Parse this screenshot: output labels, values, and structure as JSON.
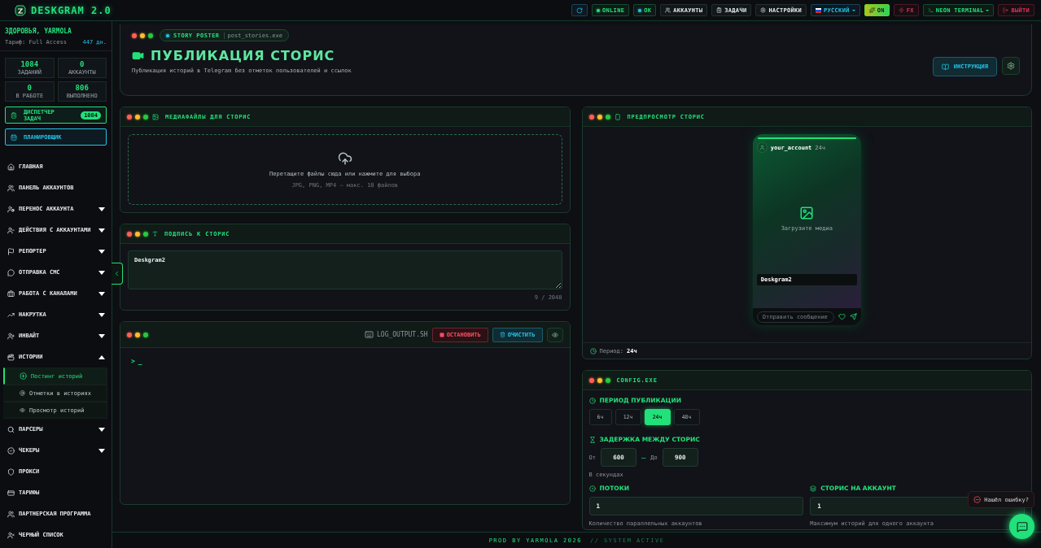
{
  "topbar": {
    "logo": "DESKGRAM 2.0",
    "buttons": [
      {
        "kind": "refresh"
      },
      {
        "kind": "status",
        "label": "ONLINE"
      },
      {
        "kind": "status",
        "label": "OK"
      },
      {
        "kind": "nav",
        "label": "АККАУНТЫ"
      },
      {
        "kind": "nav",
        "label": "ЗАДАЧИ"
      },
      {
        "kind": "nav",
        "label": "НАСТРОЙКИ"
      },
      {
        "kind": "lang",
        "label": "РУССКИЙ"
      },
      {
        "kind": "toggle",
        "label": "ON",
        "on": true
      },
      {
        "kind": "fx",
        "label": "FX"
      },
      {
        "kind": "theme",
        "label": "NEON TERMINAL"
      },
      {
        "kind": "logout",
        "label": "ВЫЙТИ"
      }
    ]
  },
  "sidebar": {
    "greeting": "ЗДОРОВЬЯ, YARMOLA",
    "tariff": "Тариф: Full Access",
    "days": "447 дн.",
    "stats": [
      {
        "value": "1084",
        "label": "ЗАДАНИЙ"
      },
      {
        "value": "0",
        "label": "АККАУНТЫ"
      },
      {
        "value": "0",
        "label": "В РАБОТЕ"
      },
      {
        "value": "806",
        "label": "ВЫПОЛНЕНО"
      }
    ],
    "task_dispatcher": {
      "label": "ДИСПЕТЧЕР ЗАДАЧ",
      "badge": "1084"
    },
    "scheduler": {
      "label": "ПЛАНИРОВЩИК"
    },
    "items": [
      {
        "label": "ГЛАВНАЯ"
      },
      {
        "label": "ПАНЕЛЬ АККАУНТОВ"
      },
      {
        "label": "ПЕРЕНОС АККАУНТА",
        "expanded": false
      },
      {
        "label": "ДЕЙСТВИЯ С АККАУНТАМИ",
        "expanded": false
      },
      {
        "label": "РЕПОРТЕР",
        "expanded": false
      },
      {
        "label": "ОТПРАВКА СМС",
        "expanded": false
      },
      {
        "label": "РАБОТА С КАНАЛАМИ",
        "expanded": false
      },
      {
        "label": "НАКРУТКА",
        "expanded": false
      },
      {
        "label": "ИНВАЙТ",
        "expanded": false
      },
      {
        "label": "ИСТОРИИ",
        "expanded": true,
        "children": [
          {
            "label": "Постинг историй",
            "selected": true
          },
          {
            "label": "Отметки в историях",
            "selected": false
          },
          {
            "label": "Просмотр историй",
            "selected": false
          }
        ]
      },
      {
        "label": "ПАРСЕРЫ",
        "expanded": false
      },
      {
        "label": "ЧЕКЕРЫ",
        "expanded": false
      },
      {
        "label": "ПРОКСИ"
      },
      {
        "label": "ТАРИФЫ"
      },
      {
        "label": "ПАРТНЕРСКАЯ ПРОГРАММА"
      },
      {
        "label": "ЧЕРНЫЙ СПИСОК"
      }
    ]
  },
  "header": {
    "tag": "STORY POSTER",
    "file": "post_stories.exe",
    "title": "ПУБЛИКАЦИЯ СТОРИС",
    "description": "Публикация историй в Telegram без отметок пользователей и ссылок",
    "instruction_button": "ИНСТРУКЦИЯ"
  },
  "media": {
    "title": "МЕДИАФАЙЛЫ ДЛЯ СТОРИС",
    "drop_text": "Перетащите файлы сюда или нажмите для выбора",
    "drop_hint": "JPG, PNG, MP4 — макс. 10 файлов"
  },
  "caption": {
    "title": "ПОДПИСЬ К СТОРИС",
    "value": "Deskgram2",
    "counter": "9 / 2048"
  },
  "log": {
    "file": "LOG_OUTPUT.SH",
    "stop_button": "ОСТАНОВИТЬ",
    "clear_button": "ОЧИСТИТЬ",
    "prompt": ">",
    "cursor": "_"
  },
  "preview": {
    "title": "ПРЕДПРОСМОТР СТОРИС",
    "story_progress": {
      "level": 1
    },
    "account": "your_account",
    "time": "24ч",
    "placeholder_text": "Загрузите медиа",
    "caption": "Deskgram2",
    "reply_placeholder": "Отправить сообщение",
    "period_label": "Период:",
    "period_value": "24ч"
  },
  "config": {
    "title": "CONFIG.EXE",
    "period_title": "ПЕРИОД ПУБЛИКАЦИИ",
    "periods": [
      {
        "label": "6ч",
        "selected": false
      },
      {
        "label": "12ч",
        "selected": false
      },
      {
        "label": "24ч",
        "selected": true
      },
      {
        "label": "48ч",
        "selected": false
      }
    ],
    "delay_title": "ЗАДЕРЖКА МЕЖДУ СТОРИС",
    "from_label": "От",
    "from_value": "600",
    "dash": "—",
    "to_label": "До",
    "to_value": "900",
    "delay_hint": "В секундах",
    "threads_title": "ПОТОКИ",
    "threads_value": "1",
    "threads_hint": "Количество параллельных аккаунтов",
    "per_account_title": "СТОРИС НА АККАУНТ",
    "per_account_value": "1",
    "per_account_hint": "Максимум историй для одного аккаунта"
  },
  "footer": {
    "credit": "PROD BY YARMOLA 2026",
    "status": "// SYSTEM ACTIVE"
  },
  "bug_report": {
    "label": "Нашёл ошибку?"
  }
}
